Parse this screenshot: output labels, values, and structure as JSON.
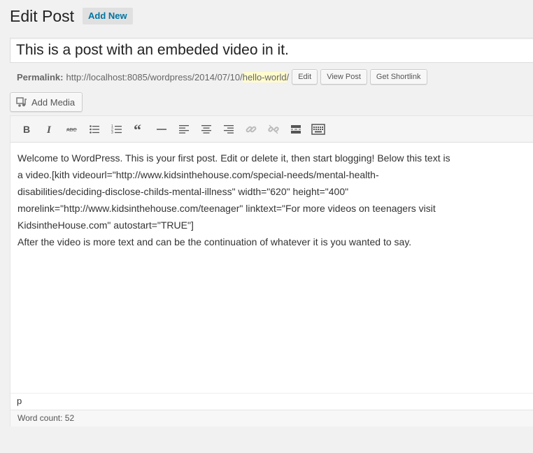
{
  "page": {
    "title": "Edit Post",
    "add_new_label": "Add New"
  },
  "post": {
    "title": "This is a post with an embeded video in it."
  },
  "permalink": {
    "label": "Permalink:",
    "url_prefix": "http://localhost:8085/wordpress/2014/07/10/",
    "slug": "hello-world",
    "url_suffix": "/",
    "edit_label": "Edit",
    "view_label": "View Post",
    "shortlink_label": "Get Shortlink"
  },
  "media": {
    "add_media_label": "Add Media"
  },
  "toolbar": {
    "buttons": [
      "bold-icon",
      "italic-icon",
      "strikethrough-icon",
      "bulleted-list-icon",
      "numbered-list-icon",
      "blockquote-icon",
      "horizontal-line-icon",
      "align-left-icon",
      "align-center-icon",
      "align-right-icon",
      "link-icon",
      "unlink-icon",
      "read-more-icon",
      "toolbar-toggle-icon"
    ]
  },
  "content": {
    "paragraph1": "Welcome to WordPress. This is your first post. Edit or delete it, then start blogging! Below this text is a video.[kith videourl=\"http://www.kidsinthehouse.com/special-needs/mental-health-disabilities/deciding-disclose-childs-mental-illness\" width=\"620\" height=\"400\" morelink=\"http://www.kidsinthehouse.com/teenager\" linktext=\"For more videos on teenagers visit KidsintheHouse.com\" autostart=\"TRUE\"]",
    "paragraph2": "After the video is more text and can be the continuation of whatever it is you wanted to say."
  },
  "editor": {
    "path": "p",
    "word_count": "Word count: 52"
  }
}
